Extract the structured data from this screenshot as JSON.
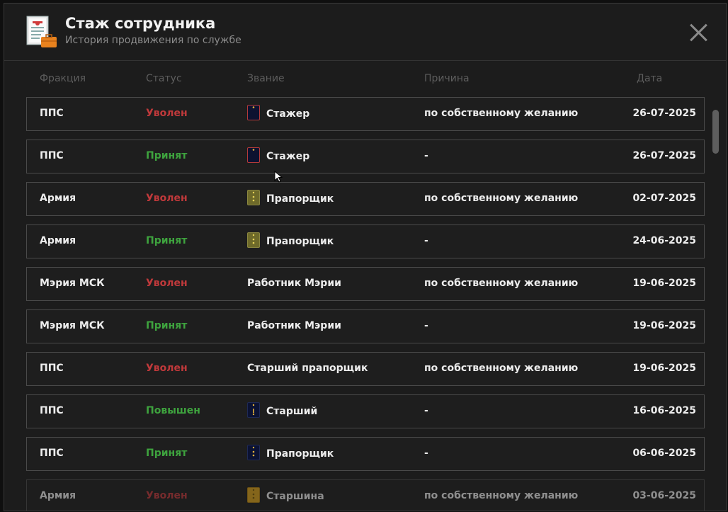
{
  "header": {
    "title": "Стаж сотрудника",
    "subtitle": "История продвижения по службе",
    "icon": "document-briefcase-icon"
  },
  "columns": {
    "faction": "Фракция",
    "status": "Статус",
    "rank": "Звание",
    "reason": "Причина",
    "date": "Дата"
  },
  "colors": {
    "fired": "#c0393b",
    "hired": "#3ea33e",
    "background": "#1c1c1c"
  },
  "rows": [
    {
      "faction": "ППС",
      "status": "Уволен",
      "status_type": "fired",
      "rank": "Стажер",
      "rank_icon": "stazher",
      "reason": "по собственному желанию",
      "date": "26-07-2025"
    },
    {
      "faction": "ППС",
      "status": "Принят",
      "status_type": "hired",
      "rank": "Стажер",
      "rank_icon": "stazher",
      "reason": "-",
      "date": "26-07-2025"
    },
    {
      "faction": "Армия",
      "status": "Уволен",
      "status_type": "fired",
      "rank": "Прапорщик",
      "rank_icon": "army-praporshik",
      "reason": "по собственному желанию",
      "date": "02-07-2025"
    },
    {
      "faction": "Армия",
      "status": "Принят",
      "status_type": "hired",
      "rank": "Прапорщик",
      "rank_icon": "army-praporshik",
      "reason": "-",
      "date": "24-06-2025"
    },
    {
      "faction": "Мэрия МСК",
      "status": "Уволен",
      "status_type": "fired",
      "rank": "Работник Мэрии",
      "rank_icon": "",
      "reason": "по собственному желанию",
      "date": "19-06-2025"
    },
    {
      "faction": "Мэрия МСК",
      "status": "Принят",
      "status_type": "hired",
      "rank": "Работник Мэрии",
      "rank_icon": "",
      "reason": "-",
      "date": "19-06-2025"
    },
    {
      "faction": "ППС",
      "status": "Уволен",
      "status_type": "fired",
      "rank": "Старший прапорщик",
      "rank_icon": "",
      "reason": "по собственному желанию",
      "date": "19-06-2025"
    },
    {
      "faction": "ППС",
      "status": "Повышен",
      "status_type": "hired",
      "rank": "Старший",
      "rank_icon": "police-starshiy",
      "reason": "-",
      "date": "16-06-2025"
    },
    {
      "faction": "ППС",
      "status": "Принят",
      "status_type": "hired",
      "rank": "Прапорщик",
      "rank_icon": "police-praporshik",
      "reason": "-",
      "date": "06-06-2025"
    },
    {
      "faction": "Армия",
      "status": "Уволен",
      "status_type": "fired",
      "rank": "Старшина",
      "rank_icon": "gold-starshina",
      "reason": "по собственному желанию",
      "date": "03-06-2025"
    }
  ]
}
